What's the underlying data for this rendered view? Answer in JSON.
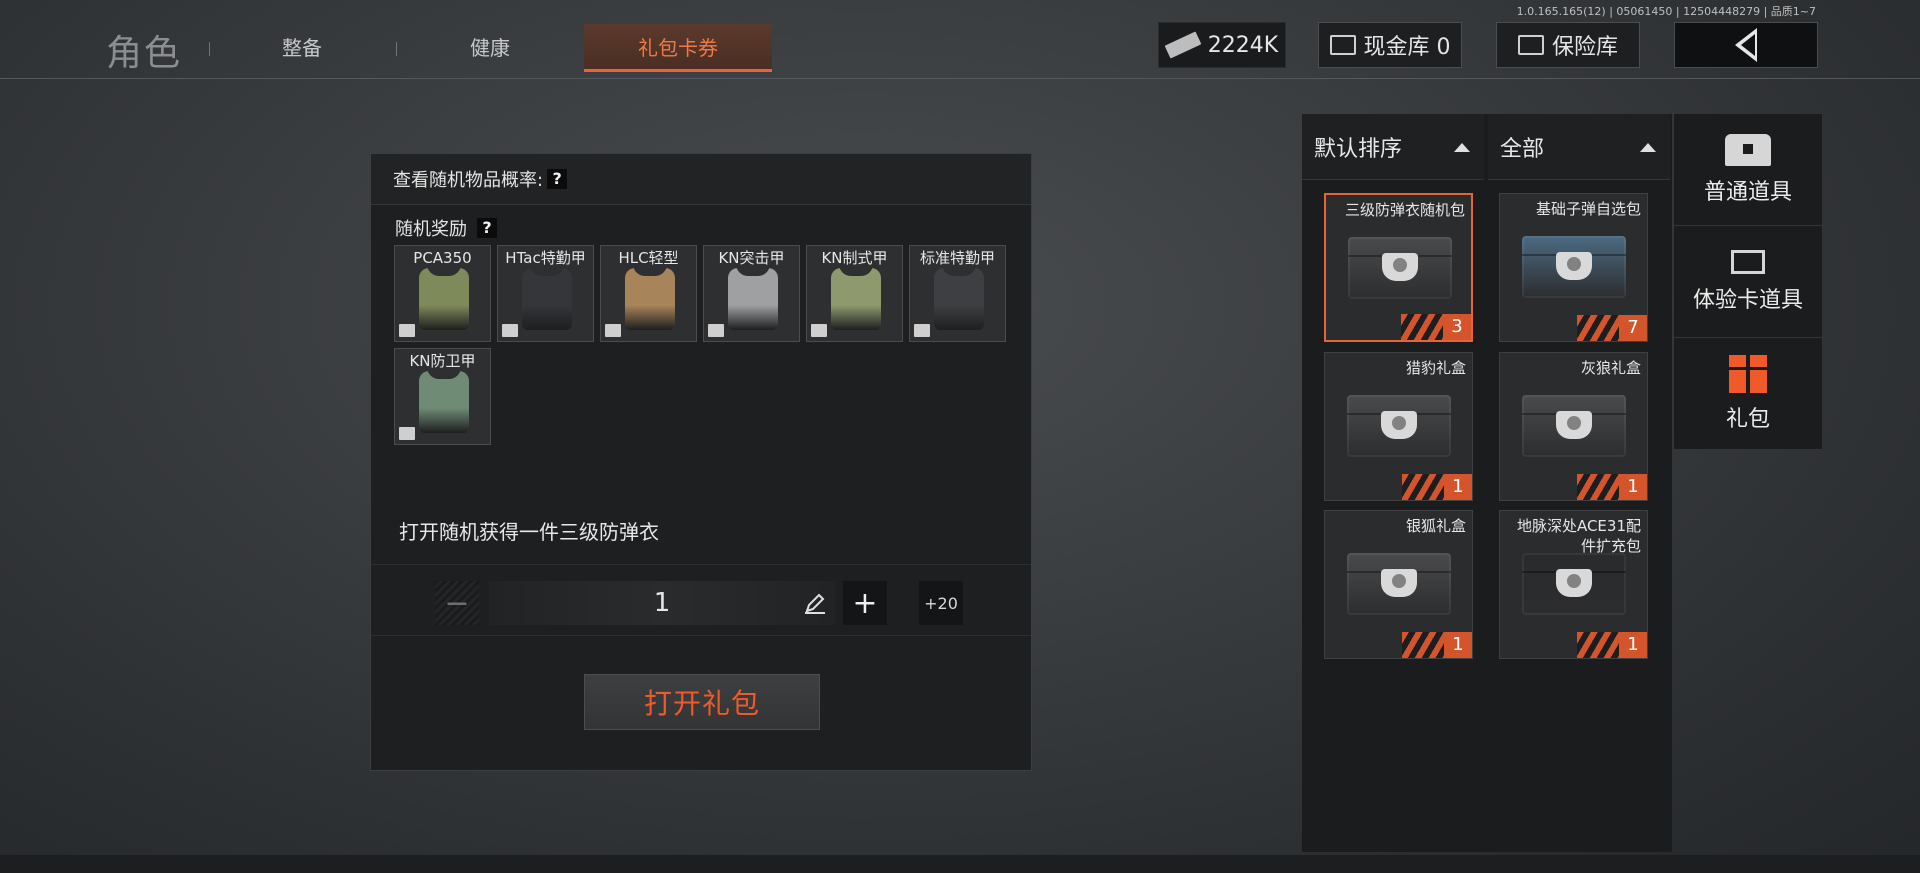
{
  "version": "1.0.165.165(12) | 05061450 | 12504448279 | 品质1~7",
  "nav": {
    "title": "角色",
    "tabs": [
      {
        "label": "整备",
        "active": false
      },
      {
        "label": "健康",
        "active": false
      },
      {
        "label": "礼包卡券",
        "active": true
      }
    ]
  },
  "top": {
    "money": "2224K",
    "cash_vault": "现金库 0",
    "safe": "保险库"
  },
  "dialog": {
    "check_rate": "查看随机物品概率:",
    "help": "?",
    "reward_label": "随机奖励",
    "rewards": [
      {
        "name": "PCA350",
        "color": "#7f8a5a"
      },
      {
        "name": "HTac特勤甲",
        "color": "#34363a"
      },
      {
        "name": "HLC轻型",
        "color": "#a8845a"
      },
      {
        "name": "KN突击甲",
        "color": "#9ea0a2"
      },
      {
        "name": "KN制式甲",
        "color": "#8e9a6d"
      },
      {
        "name": "标准特勤甲",
        "color": "#3d3f42"
      },
      {
        "name": "KN防卫甲",
        "color": "#6f8a75"
      }
    ],
    "description": "打开随机获得一件三级防弹衣",
    "quantity": "1",
    "plus20": "+20",
    "open_button": "打开礼包"
  },
  "sort": {
    "order": "默认排序",
    "filter": "全部"
  },
  "inventory": [
    {
      "name": "三级防弹衣随机包",
      "count": "3",
      "selected": true,
      "case_color": "#4a4b4d"
    },
    {
      "name": "基础子弹自选包",
      "count": "7",
      "selected": false,
      "case_color": "#4d6b82"
    },
    {
      "name": "猎豹礼盒",
      "count": "1",
      "selected": false,
      "case_color": "#4a4b4d"
    },
    {
      "name": "灰狼礼盒",
      "count": "1",
      "selected": false,
      "case_color": "#4a4b4d"
    },
    {
      "name": "银狐礼盒",
      "count": "1",
      "selected": false,
      "case_color": "#4a4b4d"
    },
    {
      "name": "地脉深处ACE31配件扩充包",
      "count": "1",
      "selected": false,
      "case_color": "#2a2b2d"
    }
  ],
  "categories": [
    {
      "label": "普通道具",
      "icon": "chest-icon"
    },
    {
      "label": "体验卡道具",
      "icon": "card-icon"
    },
    {
      "label": "礼包",
      "icon": "gift-icon",
      "accent": "#f05a28"
    }
  ],
  "colors": {
    "accent": "#e8623a",
    "open_button_text": "#f05a28"
  }
}
